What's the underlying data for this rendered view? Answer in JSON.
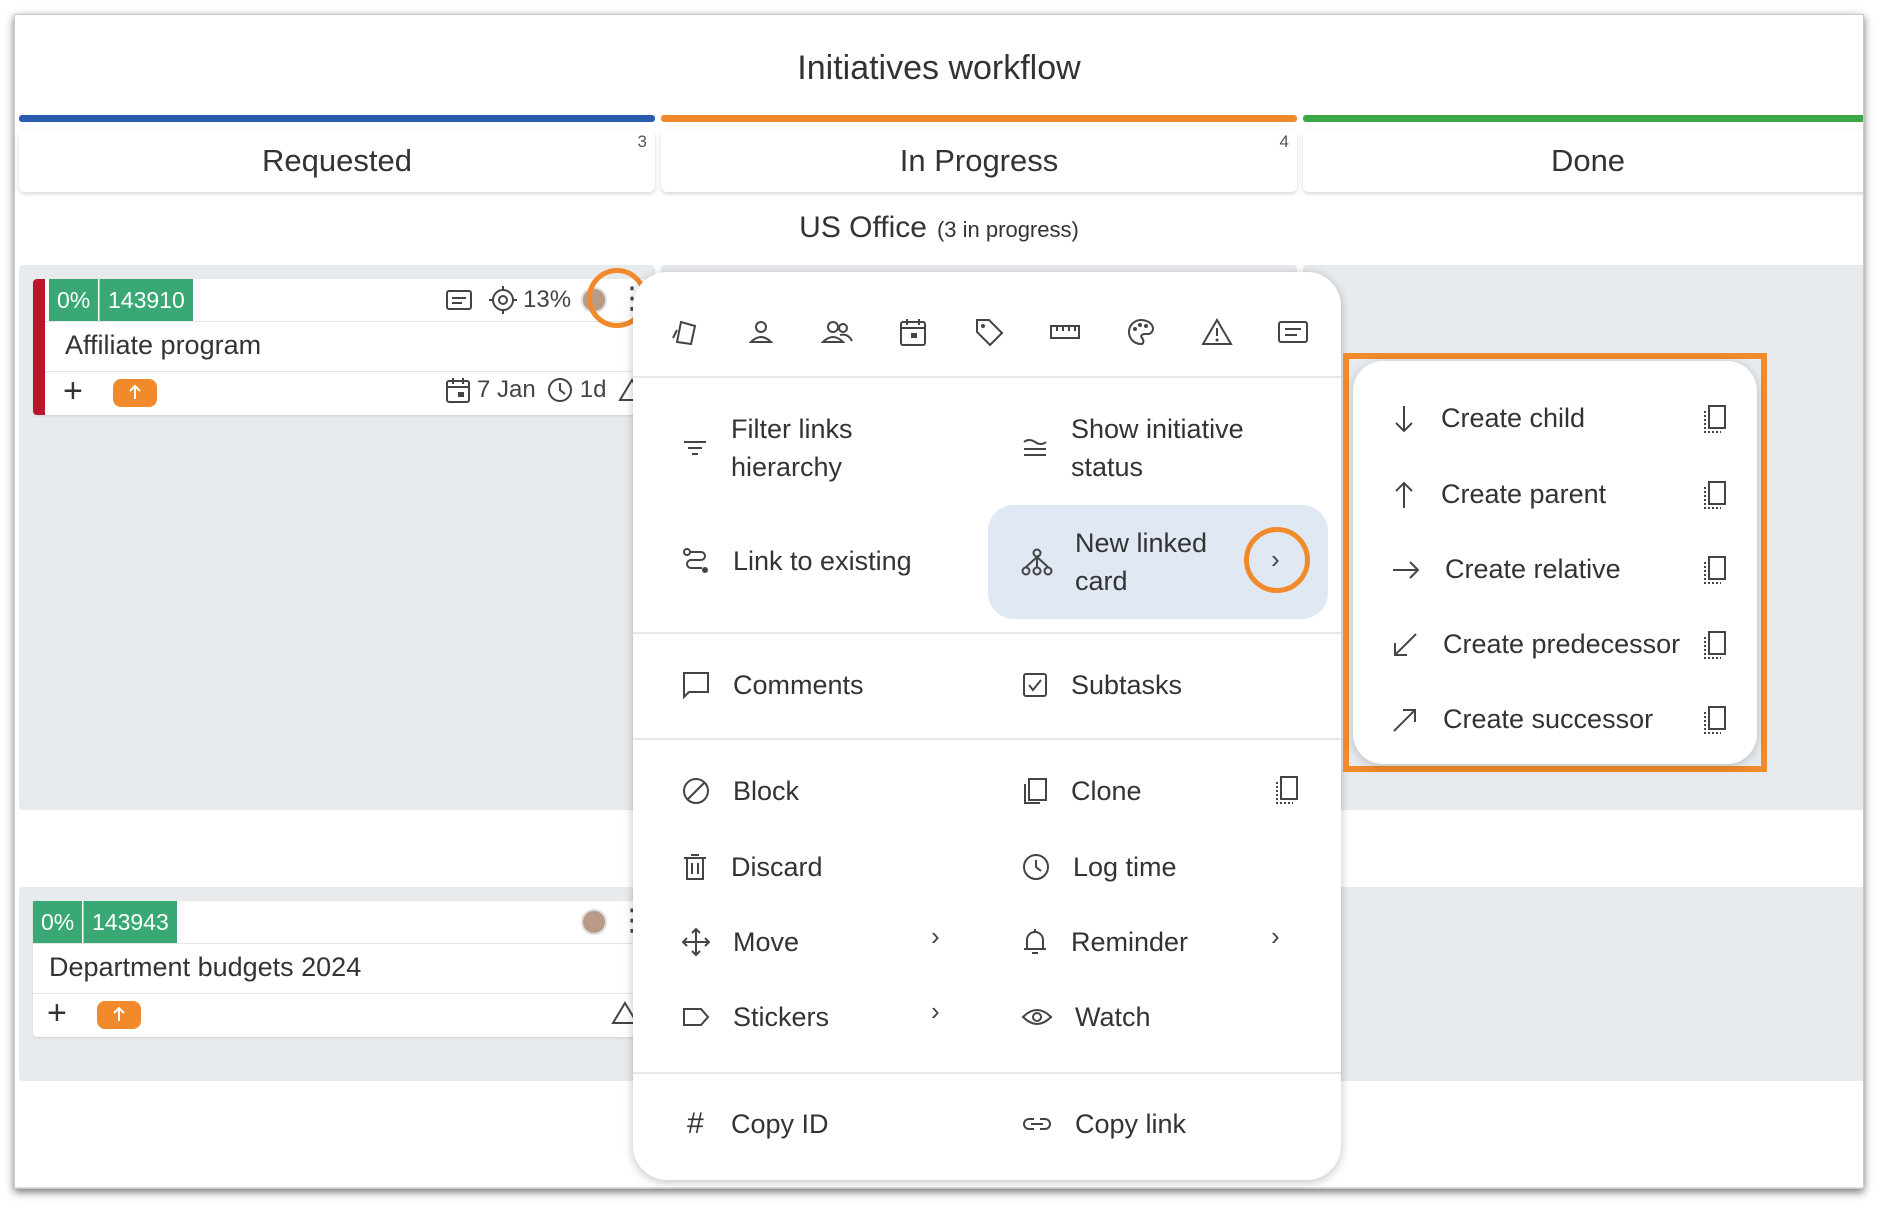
{
  "board": {
    "title": "Initiatives workflow"
  },
  "columns": [
    {
      "label": "Requested",
      "count": "3",
      "color": "#2a5db0"
    },
    {
      "label": "In Progress",
      "count": "4",
      "color": "#f08a2a"
    },
    {
      "label": "Done",
      "count": "",
      "color": "#3aa845"
    }
  ],
  "lane": {
    "title": "US Office",
    "subtitle": "(3 in progress)"
  },
  "cards": [
    {
      "percent": "0%",
      "id": "143910",
      "title": "Affiliate program",
      "progress": "13%",
      "date": "7 Jan",
      "duration": "1d",
      "priority_icon": "arrow-up-icon"
    },
    {
      "percent": "0%",
      "id": "143943",
      "title": "Department budgets 2024",
      "priority_icon": "arrow-up-icon"
    }
  ],
  "menu": {
    "toolbar_icons": [
      "card-type-icon",
      "user-icon",
      "users-icon",
      "calendar-icon",
      "tag-icon",
      "ruler-icon",
      "palette-icon",
      "warning-icon",
      "card-details-icon"
    ],
    "filter_links": "Filter links hierarchy",
    "show_status": "Show initiative status",
    "link_existing": "Link to existing",
    "new_linked": "New linked card",
    "comments": "Comments",
    "subtasks": "Subtasks",
    "block": "Block",
    "clone": "Clone",
    "discard": "Discard",
    "log_time": "Log time",
    "move": "Move",
    "reminder": "Reminder",
    "stickers": "Stickers",
    "watch": "Watch",
    "copy_id": "Copy ID",
    "copy_link": "Copy link"
  },
  "submenu": {
    "items": [
      "Create child",
      "Create parent",
      "Create relative",
      "Create predecessor",
      "Create successor"
    ]
  },
  "accent_color": "#f08a2a"
}
